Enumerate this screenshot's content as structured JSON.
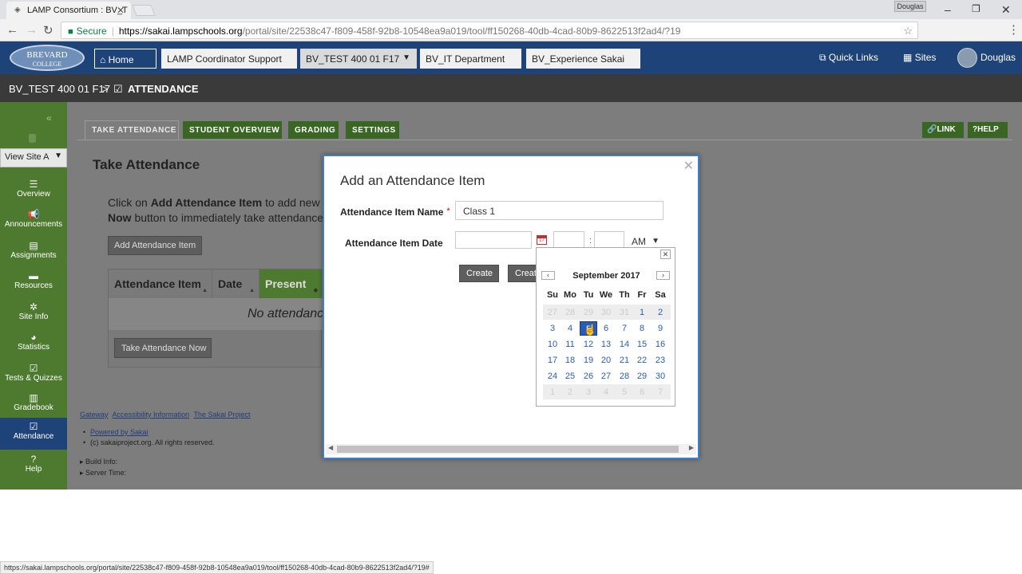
{
  "browser": {
    "tab_title": "LAMP Consortium : BV_T",
    "profile_name": "Douglas",
    "secure_label": "Secure",
    "url_host": "https://sakai.lampschools.org",
    "url_path": "/portal/site/22538c47-f809-458f-92b8-10548ea9a019/tool/ff150268-40db-4cad-80b9-8622513f2ad4/?19",
    "status_url": "https://sakai.lampschools.org/portal/site/22538c47-f809-458f-92b8-10548ea9a019/tool/ff150268-40db-4cad-80b9-8622513f2ad4/?19#"
  },
  "header": {
    "logo_line1": "BREVARD",
    "logo_line2": "COLLEGE",
    "site_tabs": [
      {
        "label": "Home"
      },
      {
        "label": "LAMP Coordinator Support"
      },
      {
        "label": "BV_TEST 400 01 F17"
      },
      {
        "label": "BV_IT Department"
      },
      {
        "label": "BV_Experience Sakai"
      }
    ],
    "quick_links": "Quick Links",
    "sites": "Sites",
    "user": "Douglas"
  },
  "breadcrumb": {
    "site": "BV_TEST 400 01 F17",
    "separator": ">",
    "tool": "ATTENDANCE"
  },
  "toolnav": {
    "view_site_as": "View Site A",
    "items": [
      {
        "label": "Overview",
        "icon": "☰"
      },
      {
        "label": "Announcements",
        "icon": "📢"
      },
      {
        "label": "Assignments",
        "icon": "▤"
      },
      {
        "label": "Resources",
        "icon": "▬"
      },
      {
        "label": "Site Info",
        "icon": "✲"
      },
      {
        "label": "Statistics",
        "icon": "◕"
      },
      {
        "label": "Tests & Quizzes",
        "icon": "☑"
      },
      {
        "label": "Gradebook",
        "icon": "▥"
      },
      {
        "label": "Attendance",
        "icon": "☑"
      },
      {
        "label": "Help",
        "icon": "?"
      }
    ]
  },
  "tool": {
    "tabs": [
      {
        "label": "TAKE ATTENDANCE"
      },
      {
        "label": "STUDENT OVERVIEW"
      },
      {
        "label": "GRADING"
      },
      {
        "label": "SETTINGS"
      }
    ],
    "link_btn": "LINK",
    "help_btn": "HELP",
    "title": "Take Attendance",
    "intro_prefix": "Click on ",
    "intro_bold1": "Add Attendance Item",
    "intro_mid": " to add new at",
    "intro_bold2": "Now",
    "intro_suffix": " button to immediately take attendance.",
    "add_button": "Add Attendance Item",
    "columns": [
      {
        "label": "Attendance Item"
      },
      {
        "label": "Date"
      },
      {
        "label": "Present"
      }
    ],
    "empty_text": "No attendance",
    "take_now_button": "Take Attendance Now"
  },
  "footer": {
    "links": [
      "Gateway",
      "Accessibility Information",
      "The Sakai Project"
    ],
    "powered": "Powered by Sakai",
    "copyright": "(c) sakaiproject.org. All rights reserved.",
    "build_info": "Build Info:",
    "server_time": "Server Time:"
  },
  "modal": {
    "title": "Add an Attendance Item",
    "name_label": "Attendance Item Name",
    "required_mark": "*",
    "name_value": "Class 1",
    "date_label": "Attendance Item Date",
    "date_value": "",
    "hour_value": "",
    "minute_value": "",
    "time_separator": ":",
    "ampm": "AM",
    "create_button": "Create",
    "create_button2": "Creat"
  },
  "datepicker": {
    "month": "September 2017",
    "dow": [
      "Su",
      "Mo",
      "Tu",
      "We",
      "Th",
      "Fr",
      "Sa"
    ],
    "weeks": [
      [
        "27",
        "28",
        "29",
        "30",
        "31",
        "1",
        "2"
      ],
      [
        "3",
        "4",
        "5",
        "6",
        "7",
        "8",
        "9"
      ],
      [
        "10",
        "11",
        "12",
        "13",
        "14",
        "15",
        "16"
      ],
      [
        "17",
        "18",
        "19",
        "20",
        "21",
        "22",
        "23"
      ],
      [
        "24",
        "25",
        "26",
        "27",
        "28",
        "29",
        "30"
      ],
      [
        "1",
        "2",
        "3",
        "4",
        "5",
        "6",
        "7"
      ]
    ],
    "selected": "5"
  }
}
